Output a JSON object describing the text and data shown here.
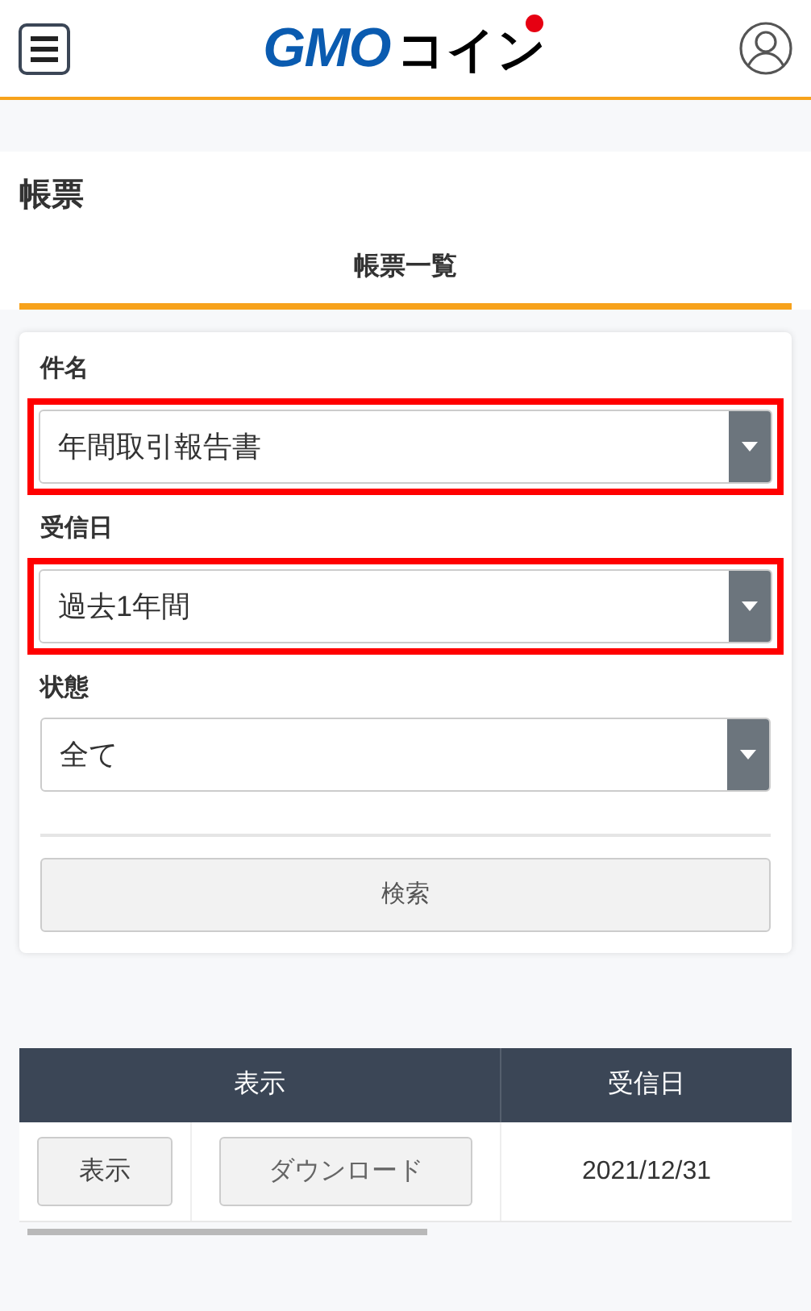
{
  "header": {
    "logo_brand": "GMO",
    "logo_service": "コイン"
  },
  "page_title": "帳票",
  "tabs": [
    {
      "label": "帳票一覧",
      "selected": true
    }
  ],
  "filters": [
    {
      "label": "件名",
      "value": "年間取引報告書",
      "highlighted": true
    },
    {
      "label": "受信日",
      "value": "過去1年間",
      "highlighted": true
    },
    {
      "label": "状態",
      "value": "全て",
      "highlighted": false
    }
  ],
  "search_button": "検索",
  "table": {
    "columns": [
      "表示",
      "受信日"
    ],
    "rows": [
      {
        "view_button": "表示",
        "download_button": "ダウンロード",
        "date": "2021/12/31"
      }
    ]
  }
}
